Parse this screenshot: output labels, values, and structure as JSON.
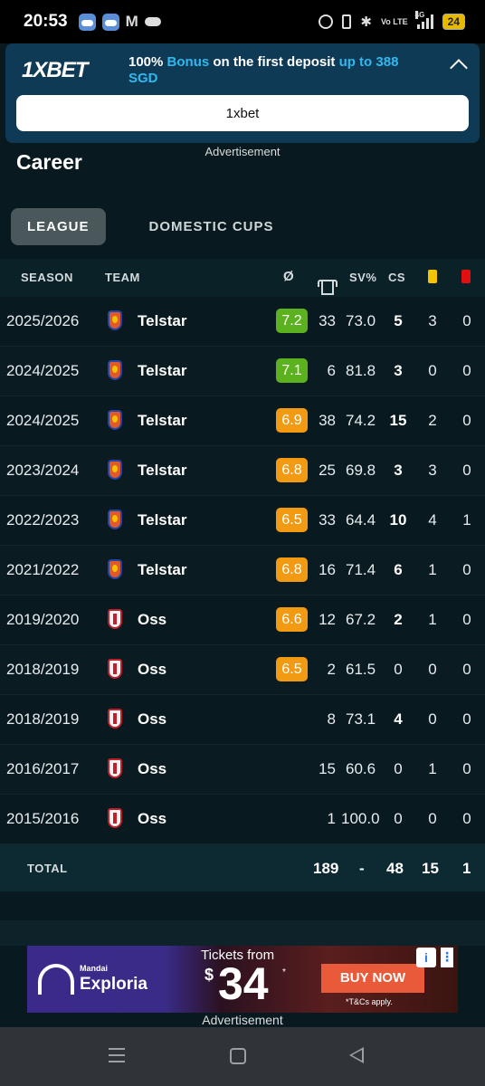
{
  "status_bar": {
    "time": "20:53",
    "gmail_icon": "M",
    "network": "4G",
    "volte": "Vo LTE",
    "battery": "24"
  },
  "ad_top": {
    "logo": "1XBET",
    "text_pre": "100% ",
    "text_bonus": "Bonus",
    "text_mid": " on the first deposit ",
    "text_upto": "up to 388",
    "text_currency": "SGD",
    "button_label": "1xbet",
    "ad_label": "Advertisement"
  },
  "career": {
    "title": "Career",
    "tabs": [
      {
        "label": "LEAGUE",
        "active": true
      },
      {
        "label": "DOMESTIC CUPS",
        "active": false
      }
    ],
    "headers": {
      "season": "SEASON",
      "team": "TEAM",
      "rating": "Ø",
      "sv": "SV%",
      "cs": "CS"
    },
    "rows": [
      {
        "season": "2025/2026",
        "team": "Telstar",
        "rating": "7.2",
        "rating_color": "green",
        "apps": "33",
        "sv": "73.0",
        "cs": "5",
        "yellow": "3",
        "red": "0"
      },
      {
        "season": "2024/2025",
        "team": "Telstar",
        "rating": "7.1",
        "rating_color": "green",
        "apps": "6",
        "sv": "81.8",
        "cs": "3",
        "yellow": "0",
        "red": "0"
      },
      {
        "season": "2024/2025",
        "team": "Telstar",
        "rating": "6.9",
        "rating_color": "orange",
        "apps": "38",
        "sv": "74.2",
        "cs": "15",
        "yellow": "2",
        "red": "0"
      },
      {
        "season": "2023/2024",
        "team": "Telstar",
        "rating": "6.8",
        "rating_color": "orange",
        "apps": "25",
        "sv": "69.8",
        "cs": "3",
        "yellow": "3",
        "red": "0"
      },
      {
        "season": "2022/2023",
        "team": "Telstar",
        "rating": "6.5",
        "rating_color": "orange",
        "apps": "33",
        "sv": "64.4",
        "cs": "10",
        "yellow": "4",
        "red": "1"
      },
      {
        "season": "2021/2022",
        "team": "Telstar",
        "rating": "6.8",
        "rating_color": "orange",
        "apps": "16",
        "sv": "71.4",
        "cs": "6",
        "yellow": "1",
        "red": "0"
      },
      {
        "season": "2019/2020",
        "team": "Oss",
        "rating": "6.6",
        "rating_color": "orange",
        "apps": "12",
        "sv": "67.2",
        "cs": "2",
        "yellow": "1",
        "red": "0"
      },
      {
        "season": "2018/2019",
        "team": "Oss",
        "rating": "6.5",
        "rating_color": "orange",
        "apps": "2",
        "sv": "61.5",
        "cs": "0",
        "yellow": "0",
        "red": "0"
      },
      {
        "season": "2018/2019",
        "team": "Oss",
        "rating": "",
        "rating_color": "",
        "apps": "8",
        "sv": "73.1",
        "cs": "4",
        "yellow": "0",
        "red": "0"
      },
      {
        "season": "2016/2017",
        "team": "Oss",
        "rating": "",
        "rating_color": "",
        "apps": "15",
        "sv": "60.6",
        "cs": "0",
        "yellow": "1",
        "red": "0"
      },
      {
        "season": "2015/2016",
        "team": "Oss",
        "rating": "",
        "rating_color": "",
        "apps": "1",
        "sv": "100.0",
        "cs": "0",
        "yellow": "0",
        "red": "0"
      }
    ],
    "total": {
      "label": "TOTAL",
      "apps": "189",
      "sv": "-",
      "cs": "48",
      "yellow": "15",
      "red": "1"
    }
  },
  "ad_bottom": {
    "brand_small": "Mandai",
    "brand": "Exploria",
    "tickets_text": "Tickets from",
    "currency": "$",
    "price": "34",
    "price_star": "*",
    "button": "BUY NOW",
    "terms": "*T&Cs apply.",
    "info": "i",
    "more": "⋮",
    "ad_label": "Advertisement"
  },
  "colors": {
    "rating_green": "#5cb11e",
    "rating_orange": "#f29a12",
    "yellow_card": "#f5c400",
    "red_card": "#e01010",
    "accent_blue": "#2fb9f0"
  }
}
